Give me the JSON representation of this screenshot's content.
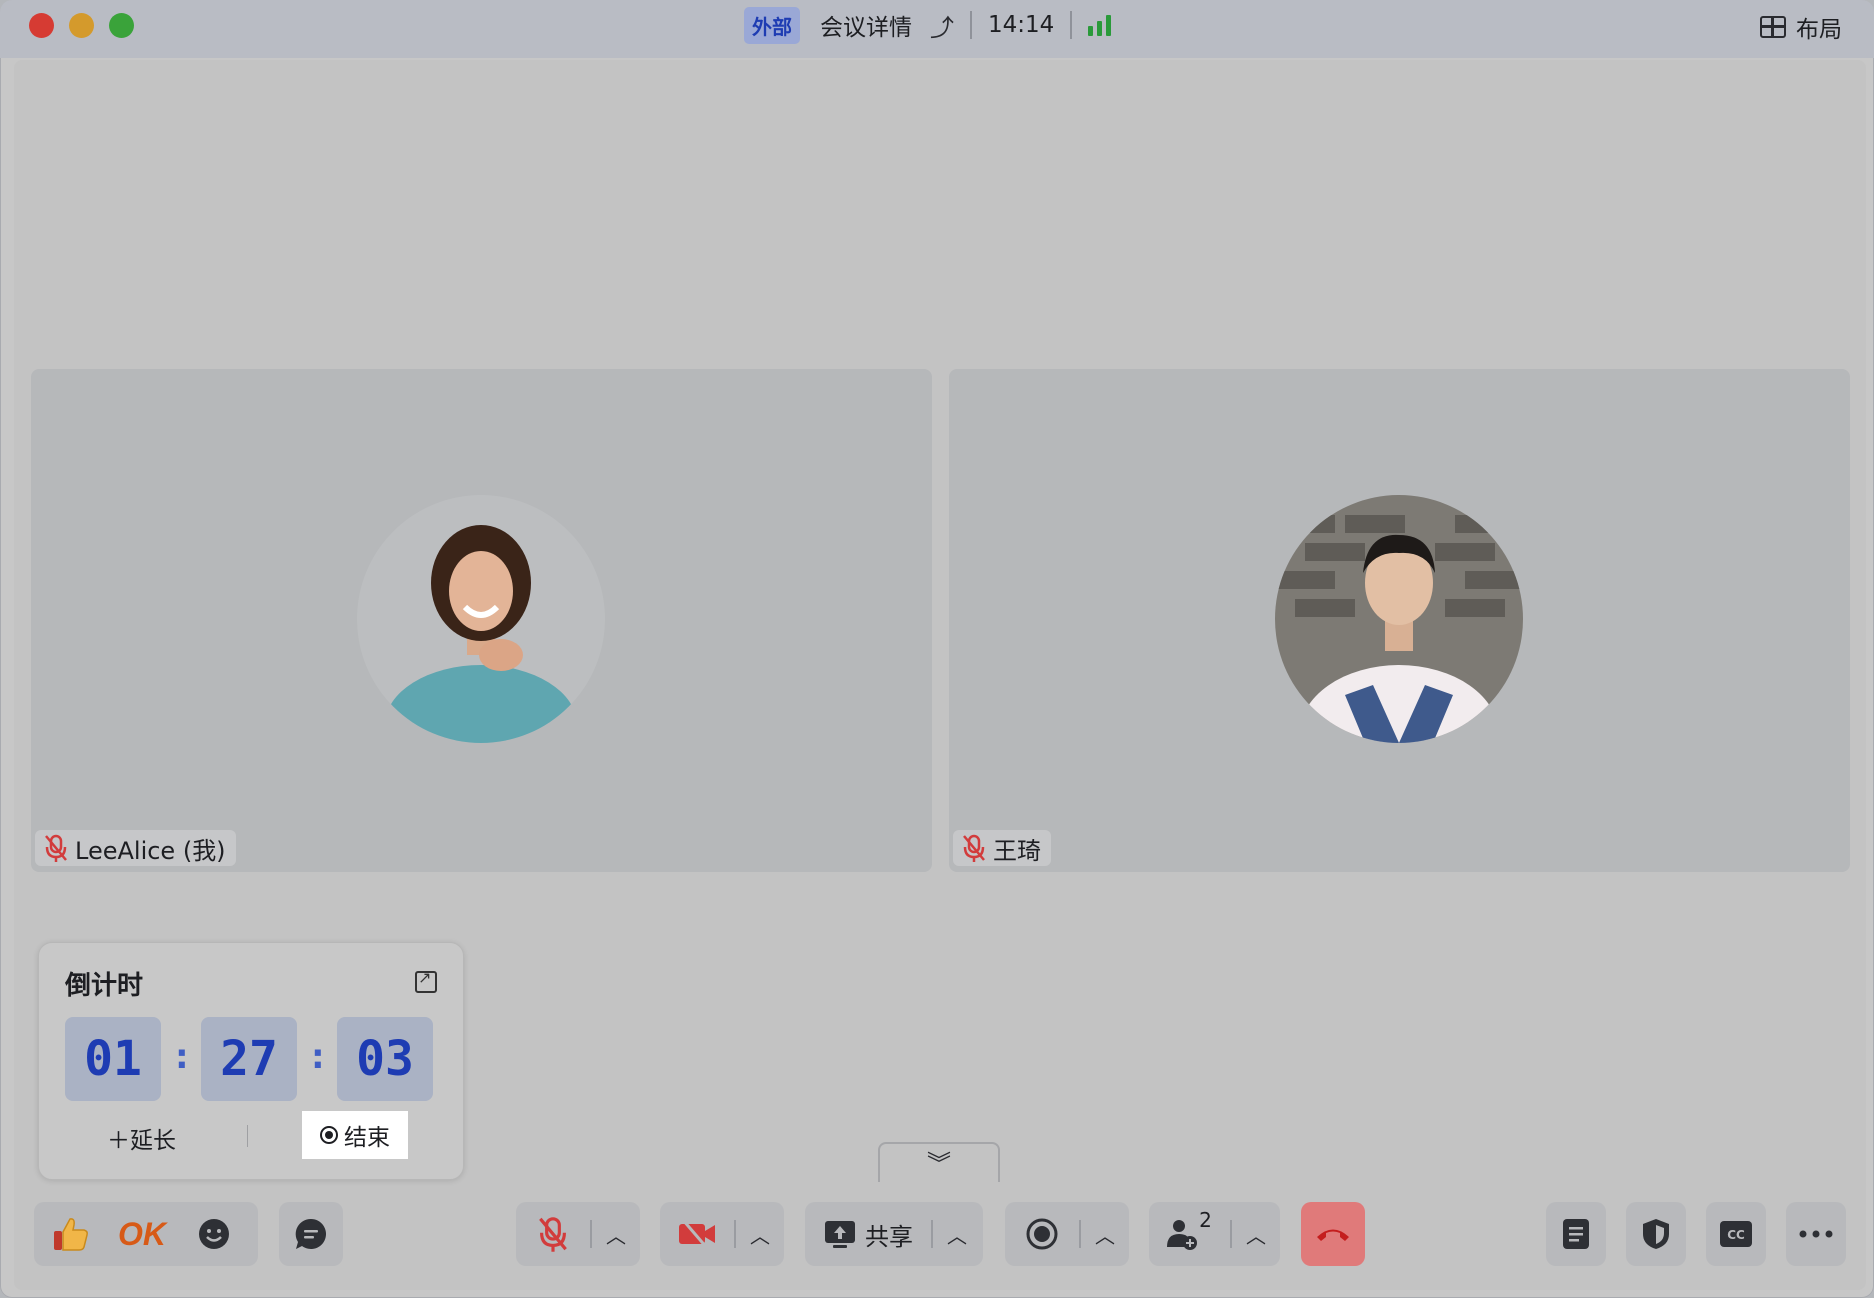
{
  "title_bar": {
    "badge": "外部",
    "meeting_details": "会议详情",
    "time": "14:14",
    "layout_label": "布局"
  },
  "participants": [
    {
      "name": "LeeAlice (我)",
      "muted": true
    },
    {
      "name": "王琦",
      "muted": true
    }
  ],
  "countdown": {
    "title": "倒计时",
    "hours": "01",
    "minutes": "27",
    "seconds": "03",
    "extend_label": "＋延长",
    "end_label": "结束"
  },
  "toolbar": {
    "reactions": [
      "thumbs-up-icon",
      "ok-icon",
      "emoji-icon"
    ],
    "ok_text": "OK",
    "share_label": "共享",
    "participant_count": "2"
  },
  "colors": {
    "accent_blue": "#1e3cb3",
    "hangup_red": "#e07a7a",
    "muted_red": "#d23c3c",
    "signal_green": "#2a9a3a"
  }
}
